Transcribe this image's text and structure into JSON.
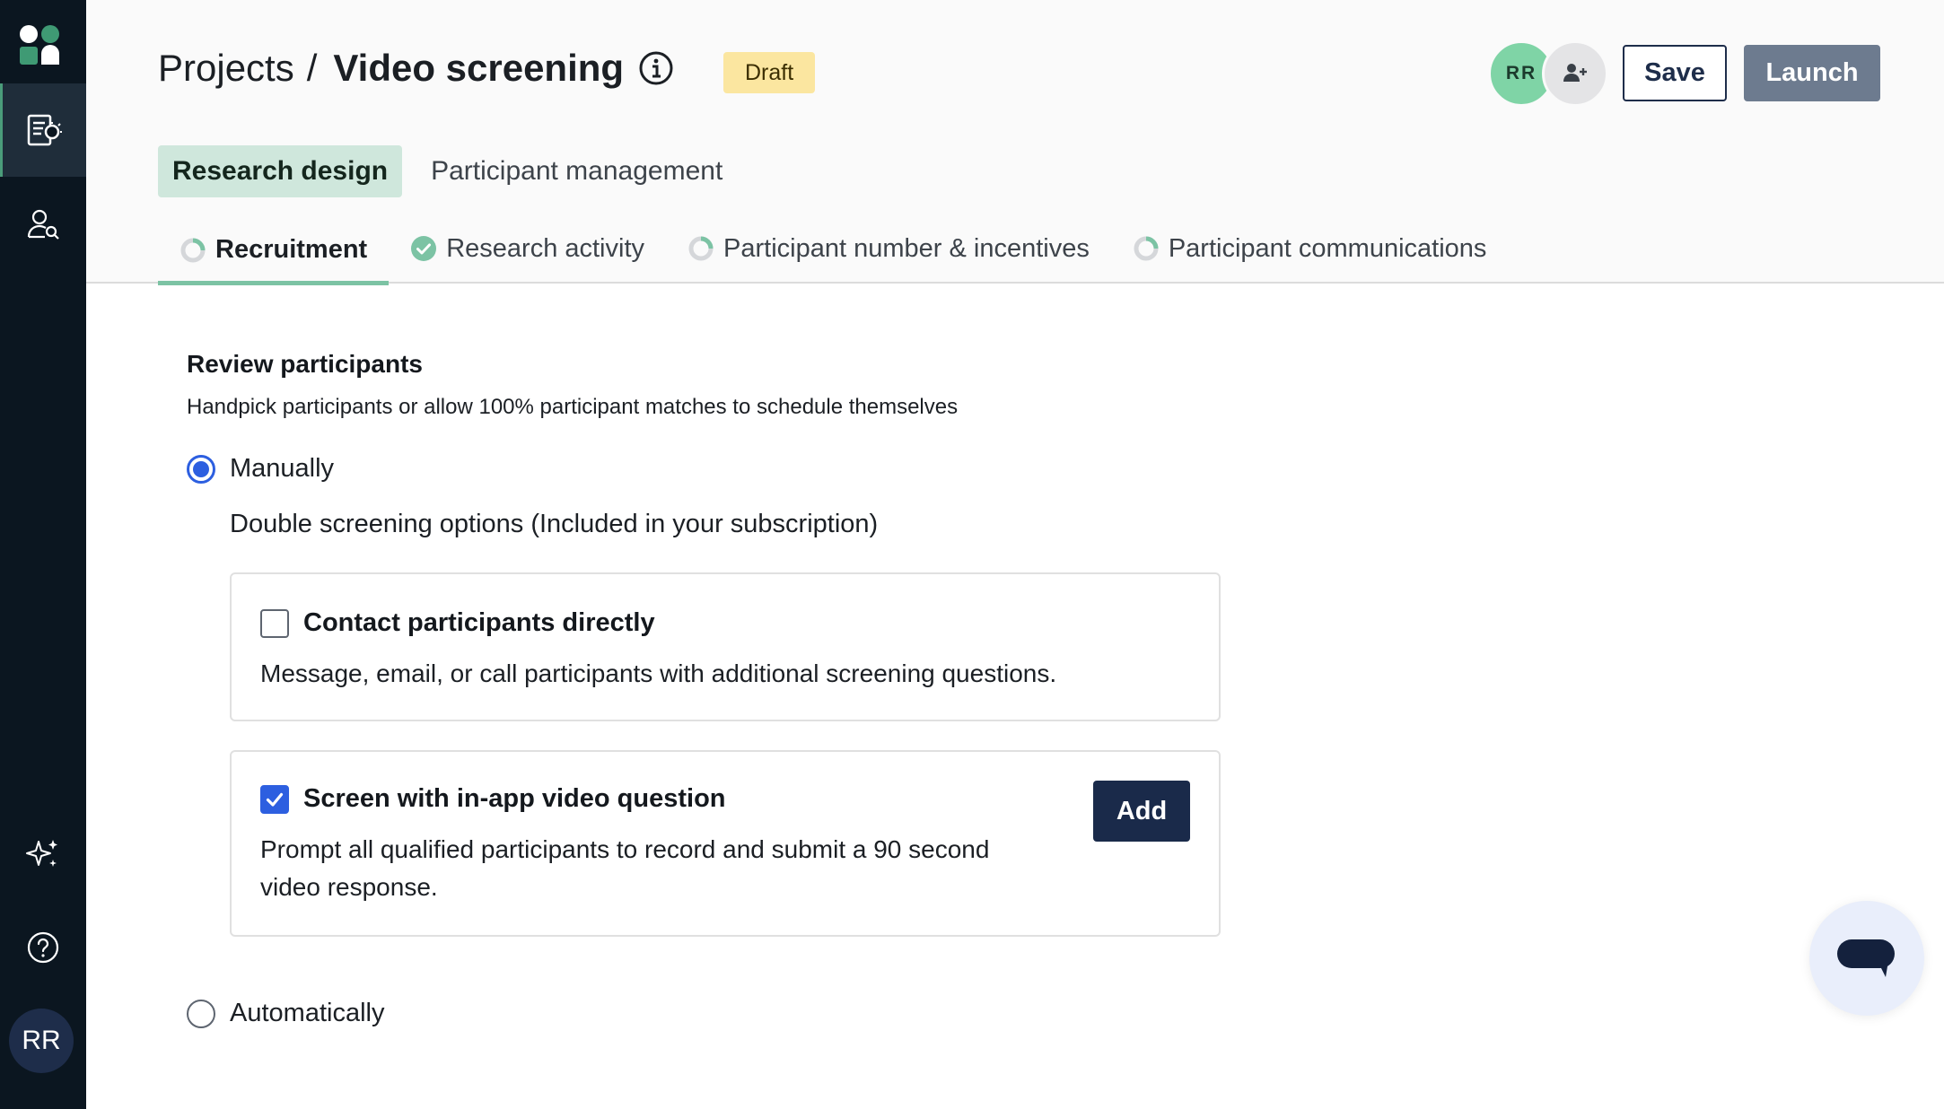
{
  "header": {
    "breadcrumb_root": "Projects",
    "breadcrumb_sep": "/",
    "project_title": "Video screening",
    "status_badge": "Draft",
    "avatar_initials": "RR",
    "save_label": "Save",
    "launch_label": "Launch"
  },
  "main_tabs": [
    {
      "label": "Research design",
      "active": true
    },
    {
      "label": "Participant management",
      "active": false
    }
  ],
  "sub_tabs": [
    {
      "label": "Recruitment",
      "status": "in-progress",
      "active": true
    },
    {
      "label": "Research activity",
      "status": "complete",
      "active": false
    },
    {
      "label": "Participant number & incentives",
      "status": "in-progress",
      "active": false
    },
    {
      "label": "Participant communications",
      "status": "in-progress",
      "active": false
    }
  ],
  "review": {
    "title": "Review participants",
    "description": "Handpick participants or allow 100% participant matches to schedule themselves",
    "option_manual": "Manually",
    "option_auto": "Automatically",
    "double_screening_label": "Double screening options  (Included in your subscription)"
  },
  "cards": [
    {
      "title": "Contact participants directly",
      "body": "Message, email, or call participants with additional screening questions.",
      "checked": false
    },
    {
      "title": "Screen with in-app video question",
      "body_line1": "Prompt all qualified participants to record and submit a 90 second",
      "body_line2": "video response.",
      "checked": true,
      "add_label": "Add"
    }
  ],
  "sidebar": {
    "user_initials": "RR",
    "icons": [
      "app-logo-icon",
      "research-projects-icon",
      "participants-search-icon",
      "ai-sparkle-icon",
      "help-icon"
    ]
  },
  "colors": {
    "sidebar_bg": "#0b1620",
    "accent_green": "#7cc3a4",
    "primary_blue": "#2d5fe0",
    "navy": "#1a2a4a",
    "badge_yellow": "#fbe6a0"
  }
}
